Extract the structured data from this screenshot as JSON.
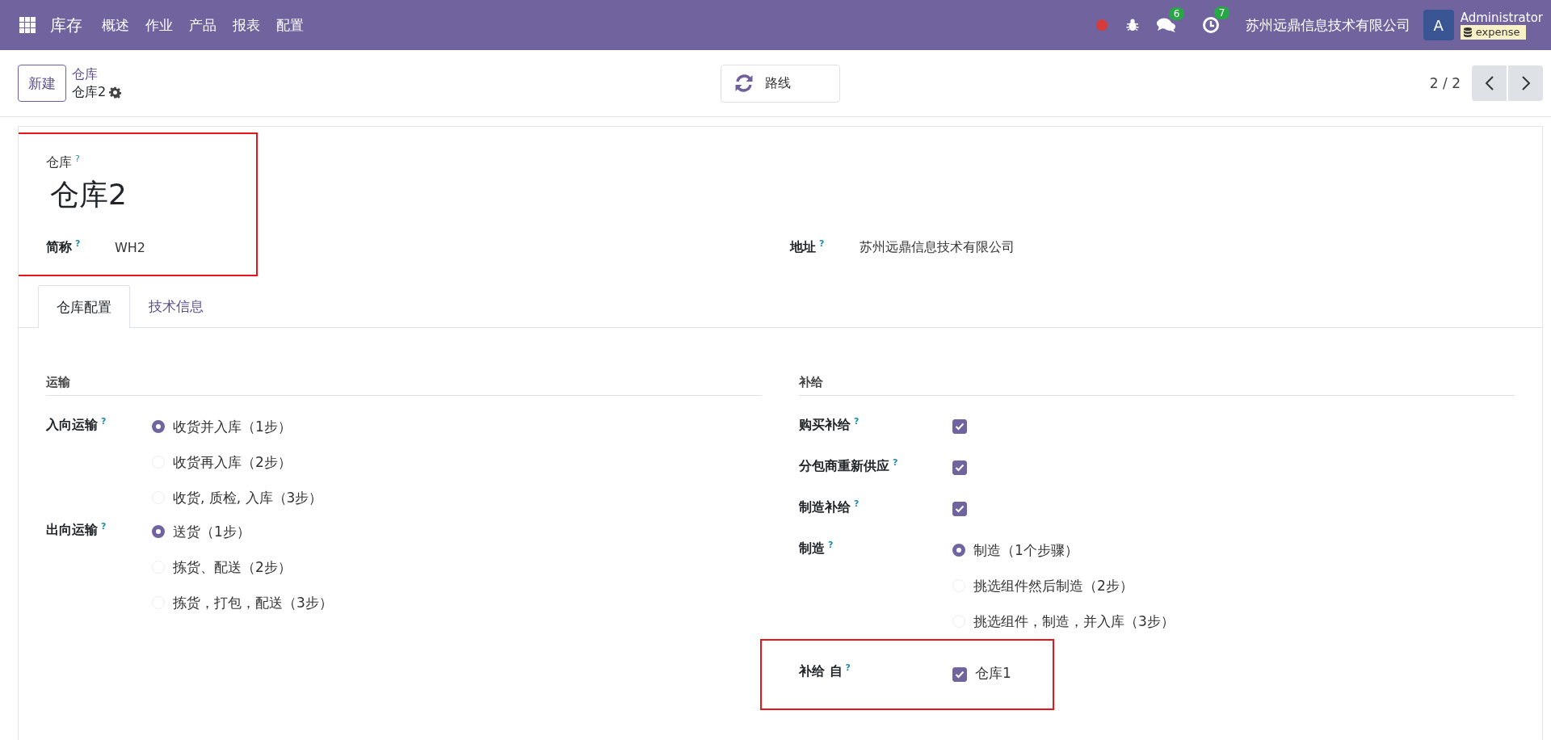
{
  "navbar": {
    "app_name": "库存",
    "menus": [
      "概述",
      "作业",
      "产品",
      "报表",
      "配置"
    ],
    "chat_count": "6",
    "activity_count": "7",
    "company": "苏州远鼎信息技术有限公司",
    "avatar_letter": "A",
    "user_name": "Administrator",
    "database": "expense"
  },
  "control_panel": {
    "new_button": "新建",
    "breadcrumb_parent": "仓库",
    "breadcrumb_current": "仓库2",
    "routes_button": "路线",
    "pager": "2 / 2"
  },
  "header": {
    "highlighted": true,
    "name_label": "仓库",
    "name_help": "?",
    "name": "仓库2",
    "short_name_label": "简称",
    "short_name_help": "?",
    "short_name": "WH2"
  },
  "address": {
    "label": "地址",
    "help": "?",
    "value": "苏州远鼎信息技术有限公司"
  },
  "tabs": [
    {
      "label": "仓库配置",
      "selected": true
    },
    {
      "label": "技术信息",
      "selected": false
    }
  ],
  "sections": [
    {
      "title": "运输",
      "fields": [
        {
          "kind": "radio",
          "label": "入向运输",
          "help": "?",
          "highlighted": false,
          "options": [
            {
              "label": "收货并入库（1步）",
              "selected": true
            },
            {
              "label": "收货再入库（2步）",
              "selected": false
            },
            {
              "label": "收货, 质检, 入库（3步）",
              "selected": false
            }
          ]
        },
        {
          "kind": "radio",
          "label": "出向运输",
          "help": "?",
          "highlighted": false,
          "options": [
            {
              "label": "送货（1步）",
              "selected": true
            },
            {
              "label": "拣货、配送（2步）",
              "selected": false
            },
            {
              "label": "拣货，打包，配送（3步）",
              "selected": false
            }
          ]
        }
      ]
    },
    {
      "title": "补给",
      "fields": [
        {
          "kind": "checkbox",
          "label": "购买补给",
          "help": "?",
          "highlighted": false,
          "checked": true
        },
        {
          "kind": "checkbox",
          "label": "分包商重新供应",
          "help": "?",
          "highlighted": false,
          "checked": true
        },
        {
          "kind": "checkbox",
          "label": "制造补给",
          "help": "?",
          "highlighted": false,
          "checked": true
        },
        {
          "kind": "radio",
          "label": "制造",
          "help": "?",
          "highlighted": false,
          "options": [
            {
              "label": "制造（1个步骤）",
              "selected": true
            },
            {
              "label": "挑选组件然后制造（2步）",
              "selected": false
            },
            {
              "label": "挑选组件，制造，并入库（3步）",
              "selected": false
            }
          ]
        },
        {
          "kind": "checklist",
          "label": "补给 自",
          "help": "?",
          "highlighted": true,
          "items": [
            {
              "label": "仓库1",
              "checked": true
            }
          ]
        }
      ]
    }
  ]
}
